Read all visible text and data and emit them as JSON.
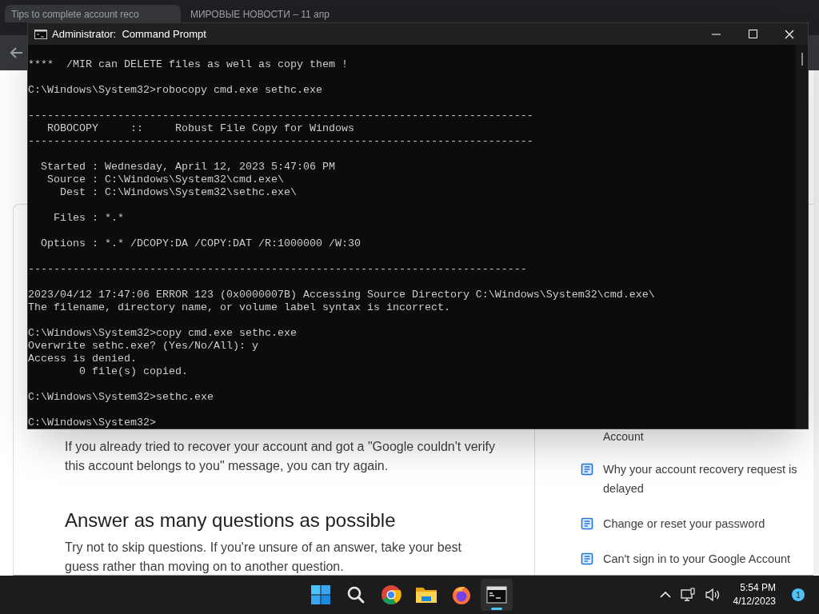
{
  "browser": {
    "tabs": [
      {
        "title": "Tips to complete account reco",
        "selected": true
      },
      {
        "title": "МИРОВЫЕ НОВОСТИ – 11 апр",
        "selected": false
      }
    ]
  },
  "page": {
    "paragraphs_top": [
      "If you already tried to recover your account and got a \"Google couldn't verify this account belongs to you\" message, you can try again."
    ],
    "heading": "Answer as many questions as possible",
    "paragraph": "Try not to skip questions. If you're unsure of an answer, take your best guess rather than moving on to another question.",
    "related_cut": "Account",
    "related": [
      "Why your account recovery request is delayed",
      "Change or reset your password",
      "Can't sign in to your Google Account"
    ]
  },
  "console": {
    "title": "Administrator:  Command Prompt",
    "blocks": [
      [
        "****  /MIR can DELETE files as well as copy them !"
      ],
      [
        "C:\\Windows\\System32>robocopy cmd.exe sethc.exe"
      ],
      [
        "-------------------------------------------------------------------------------",
        "   ROBOCOPY     ::     Robust File Copy for Windows",
        "-------------------------------------------------------------------------------"
      ],
      [
        "  Started : Wednesday, April 12, 2023 5:47:06 PM",
        "   Source : C:\\Windows\\System32\\cmd.exe\\",
        "     Dest : C:\\Windows\\System32\\sethc.exe\\"
      ],
      [
        "    Files : *.*"
      ],
      [
        "  Options : *.* /DCOPY:DA /COPY:DAT /R:1000000 /W:30"
      ],
      [
        "------------------------------------------------------------------------------"
      ],
      [
        "2023/04/12 17:47:06 ERROR 123 (0x0000007B) Accessing Source Directory C:\\Windows\\System32\\cmd.exe\\",
        "The filename, directory name, or volume label syntax is incorrect."
      ],
      [
        "C:\\Windows\\System32>copy cmd.exe sethc.exe",
        "Overwrite sethc.exe? (Yes/No/All): y",
        "Access is denied.",
        "        0 file(s) copied."
      ],
      [
        "C:\\Windows\\System32>sethc.exe"
      ],
      [
        "C:\\Windows\\System32>"
      ]
    ]
  },
  "taskbar": {
    "apps": [
      {
        "kind": "start",
        "selected": false
      },
      {
        "kind": "search",
        "selected": false
      },
      {
        "kind": "browser",
        "selected": false
      },
      {
        "kind": "folder",
        "selected": false
      },
      {
        "kind": "fox",
        "selected": false
      },
      {
        "kind": "terminal",
        "selected": true
      }
    ],
    "time": "5:54 PM",
    "date": "4/12/2023",
    "notifications": "1"
  }
}
